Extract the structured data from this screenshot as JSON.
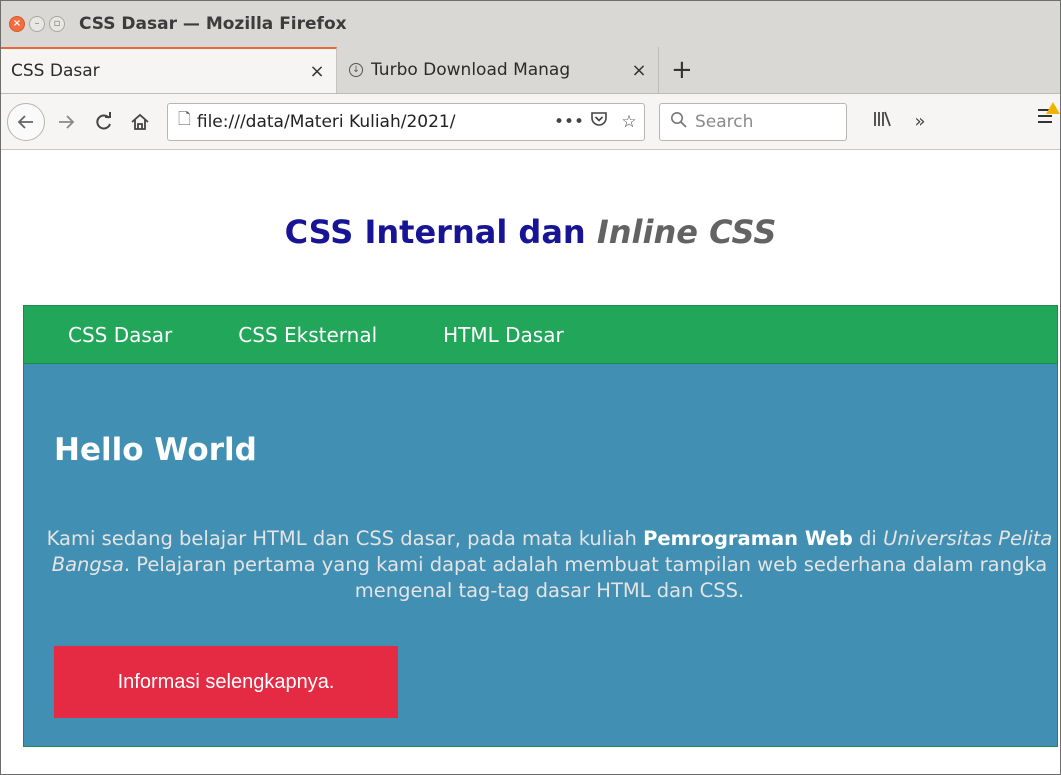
{
  "window": {
    "title": "CSS Dasar — Mozilla Firefox"
  },
  "tabs": [
    {
      "label": "CSS Dasar",
      "close": "×"
    },
    {
      "label": "Turbo Download Manag",
      "close": "×"
    }
  ],
  "new_tab": "+",
  "navbar": {
    "url": "file:///data/Materi Kuliah/2021/",
    "search_placeholder": "Search"
  },
  "page": {
    "heading_main": "CSS Internal dan ",
    "heading_italic": "Inline CSS",
    "menu": [
      "CSS Dasar",
      "CSS Eksternal",
      "HTML Dasar"
    ],
    "hello": "Hello World",
    "paragraph": {
      "part1": "Kami sedang belajar HTML dan CSS dasar, pada mata kuliah ",
      "bold": "Pemrograman Web",
      "part2": " di ",
      "italic": "Universitas Pelita Bangsa",
      "part3": ". Pelajaran pertama yang kami dapat adalah membuat tampilan web sederhana dalam rangka mengenal tag-tag dasar HTML dan CSS."
    },
    "button": "Informasi selengkapnya."
  },
  "colors": {
    "heading": "#171496",
    "menu_bg": "#22a75a",
    "content_bg": "#418fb2",
    "button_bg": "#e42b43"
  }
}
